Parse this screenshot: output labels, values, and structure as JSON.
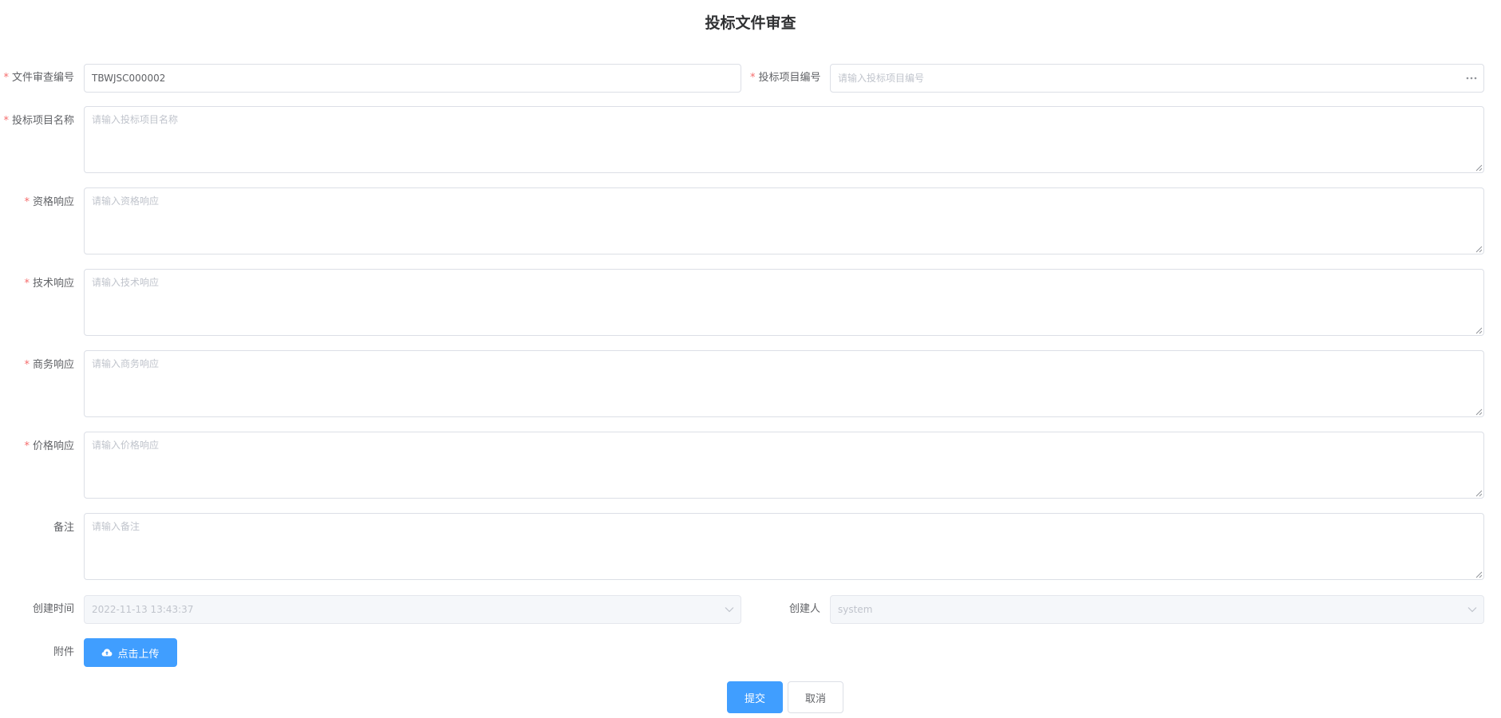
{
  "page": {
    "title": "投标文件审查"
  },
  "form": {
    "review_no": {
      "label": "文件审查编号",
      "required": true,
      "value": "TBWJSC000002"
    },
    "project_no": {
      "label": "投标项目编号",
      "required": true,
      "placeholder": "请输入投标项目编号",
      "suffix_icon": "ellipsis-icon"
    },
    "project_name": {
      "label": "投标项目名称",
      "required": true,
      "placeholder": "请输入投标项目名称"
    },
    "qualification": {
      "label": "资格响应",
      "required": true,
      "placeholder": "请输入资格响应"
    },
    "technical": {
      "label": "技术响应",
      "required": true,
      "placeholder": "请输入技术响应"
    },
    "business": {
      "label": "商务响应",
      "required": true,
      "placeholder": "请输入商务响应"
    },
    "price": {
      "label": "价格响应",
      "required": true,
      "placeholder": "请输入价格响应"
    },
    "remark": {
      "label": "备注",
      "required": false,
      "placeholder": "请输入备注"
    },
    "created_time": {
      "label": "创建时间",
      "value": "2022-11-13 13:43:37",
      "disabled": true
    },
    "creator": {
      "label": "创建人",
      "value": "system",
      "disabled": true
    },
    "attachment": {
      "label": "附件",
      "upload_label": "点击上传",
      "icon": "cloud-upload-icon"
    },
    "required_mark": "*"
  },
  "actions": {
    "submit_label": "提交",
    "cancel_label": "取消"
  },
  "colors": {
    "primary": "#409eff",
    "required": "#f56c6c",
    "border": "#dcdfe6",
    "disabled_bg": "#f5f7fa"
  }
}
